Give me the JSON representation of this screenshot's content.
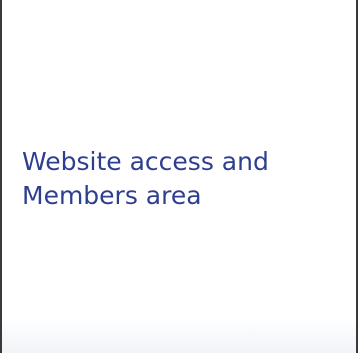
{
  "card": {
    "title": "Website access and Members area",
    "title_color": "#2f3f8f",
    "border_color": "#3a3a3a"
  }
}
